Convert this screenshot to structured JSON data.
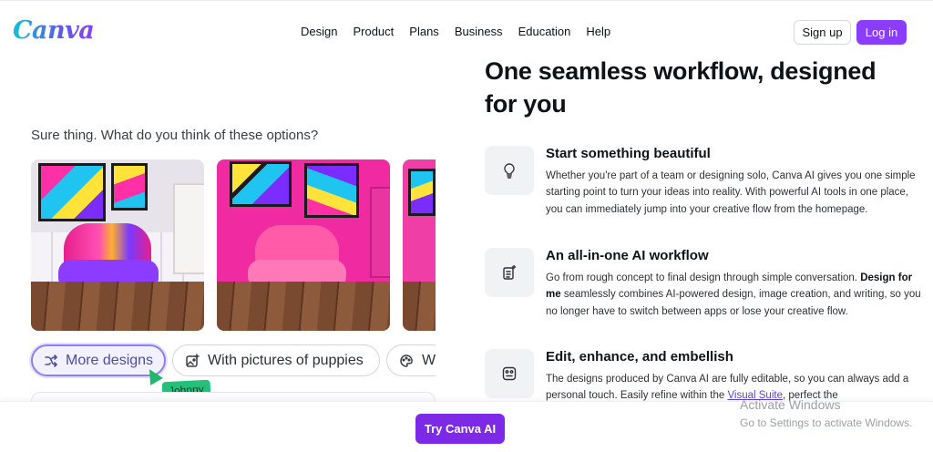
{
  "header": {
    "logo": "Canva",
    "nav": [
      "Design",
      "Product",
      "Plans",
      "Business",
      "Education",
      "Help"
    ],
    "signup_label": "Sign up",
    "login_label": "Log in"
  },
  "left": {
    "prompt": "Sure thing. What do you think of these options?",
    "chips": [
      {
        "label": "More designs",
        "icon": "shuffle-icon"
      },
      {
        "label": "With pictures of puppies",
        "icon": "image-plus-icon"
      },
      {
        "label": "Wit",
        "icon": "palette-icon"
      }
    ],
    "cursor_name": "Johnny"
  },
  "right": {
    "headline": "One seamless workflow, designed for you",
    "features": [
      {
        "icon": "lightbulb-icon",
        "title": "Start something beautiful",
        "body": "Whether you're part of a team or designing solo, Canva AI gives you one simple starting point to turn your ideas into reality. With powerful AI tools in one place, you can immediately jump into your creative flow from the homepage."
      },
      {
        "icon": "document-sparkle-icon",
        "title": "An all-in-one AI workflow",
        "body_pre": "Go from rough concept to final design through simple conversation. ",
        "body_bold": "Design for me",
        "body_post": " seamlessly combines AI-powered design, image creation, and writing, so you no longer have to switch between apps or lose your creative flow."
      },
      {
        "icon": "magic-edit-icon",
        "title": "Edit, enhance, and embellish",
        "body_pre": "The designs produced by Canva AI are fully editable, so you can always add a personal touch. Easily refine within the ",
        "body_link": "Visual Suite",
        "body_post": ", perfect the"
      }
    ]
  },
  "footer": {
    "cta": "Try Canva AI"
  },
  "watermark": {
    "line1": "Activate Windows",
    "line2": "Go to Settings to activate Windows."
  },
  "colors": {
    "brand_purple": "#8b3dff",
    "cta_purple": "#7d2ae8",
    "cursor_green": "#22c17a",
    "chip_active_border": "#8b80f0"
  }
}
